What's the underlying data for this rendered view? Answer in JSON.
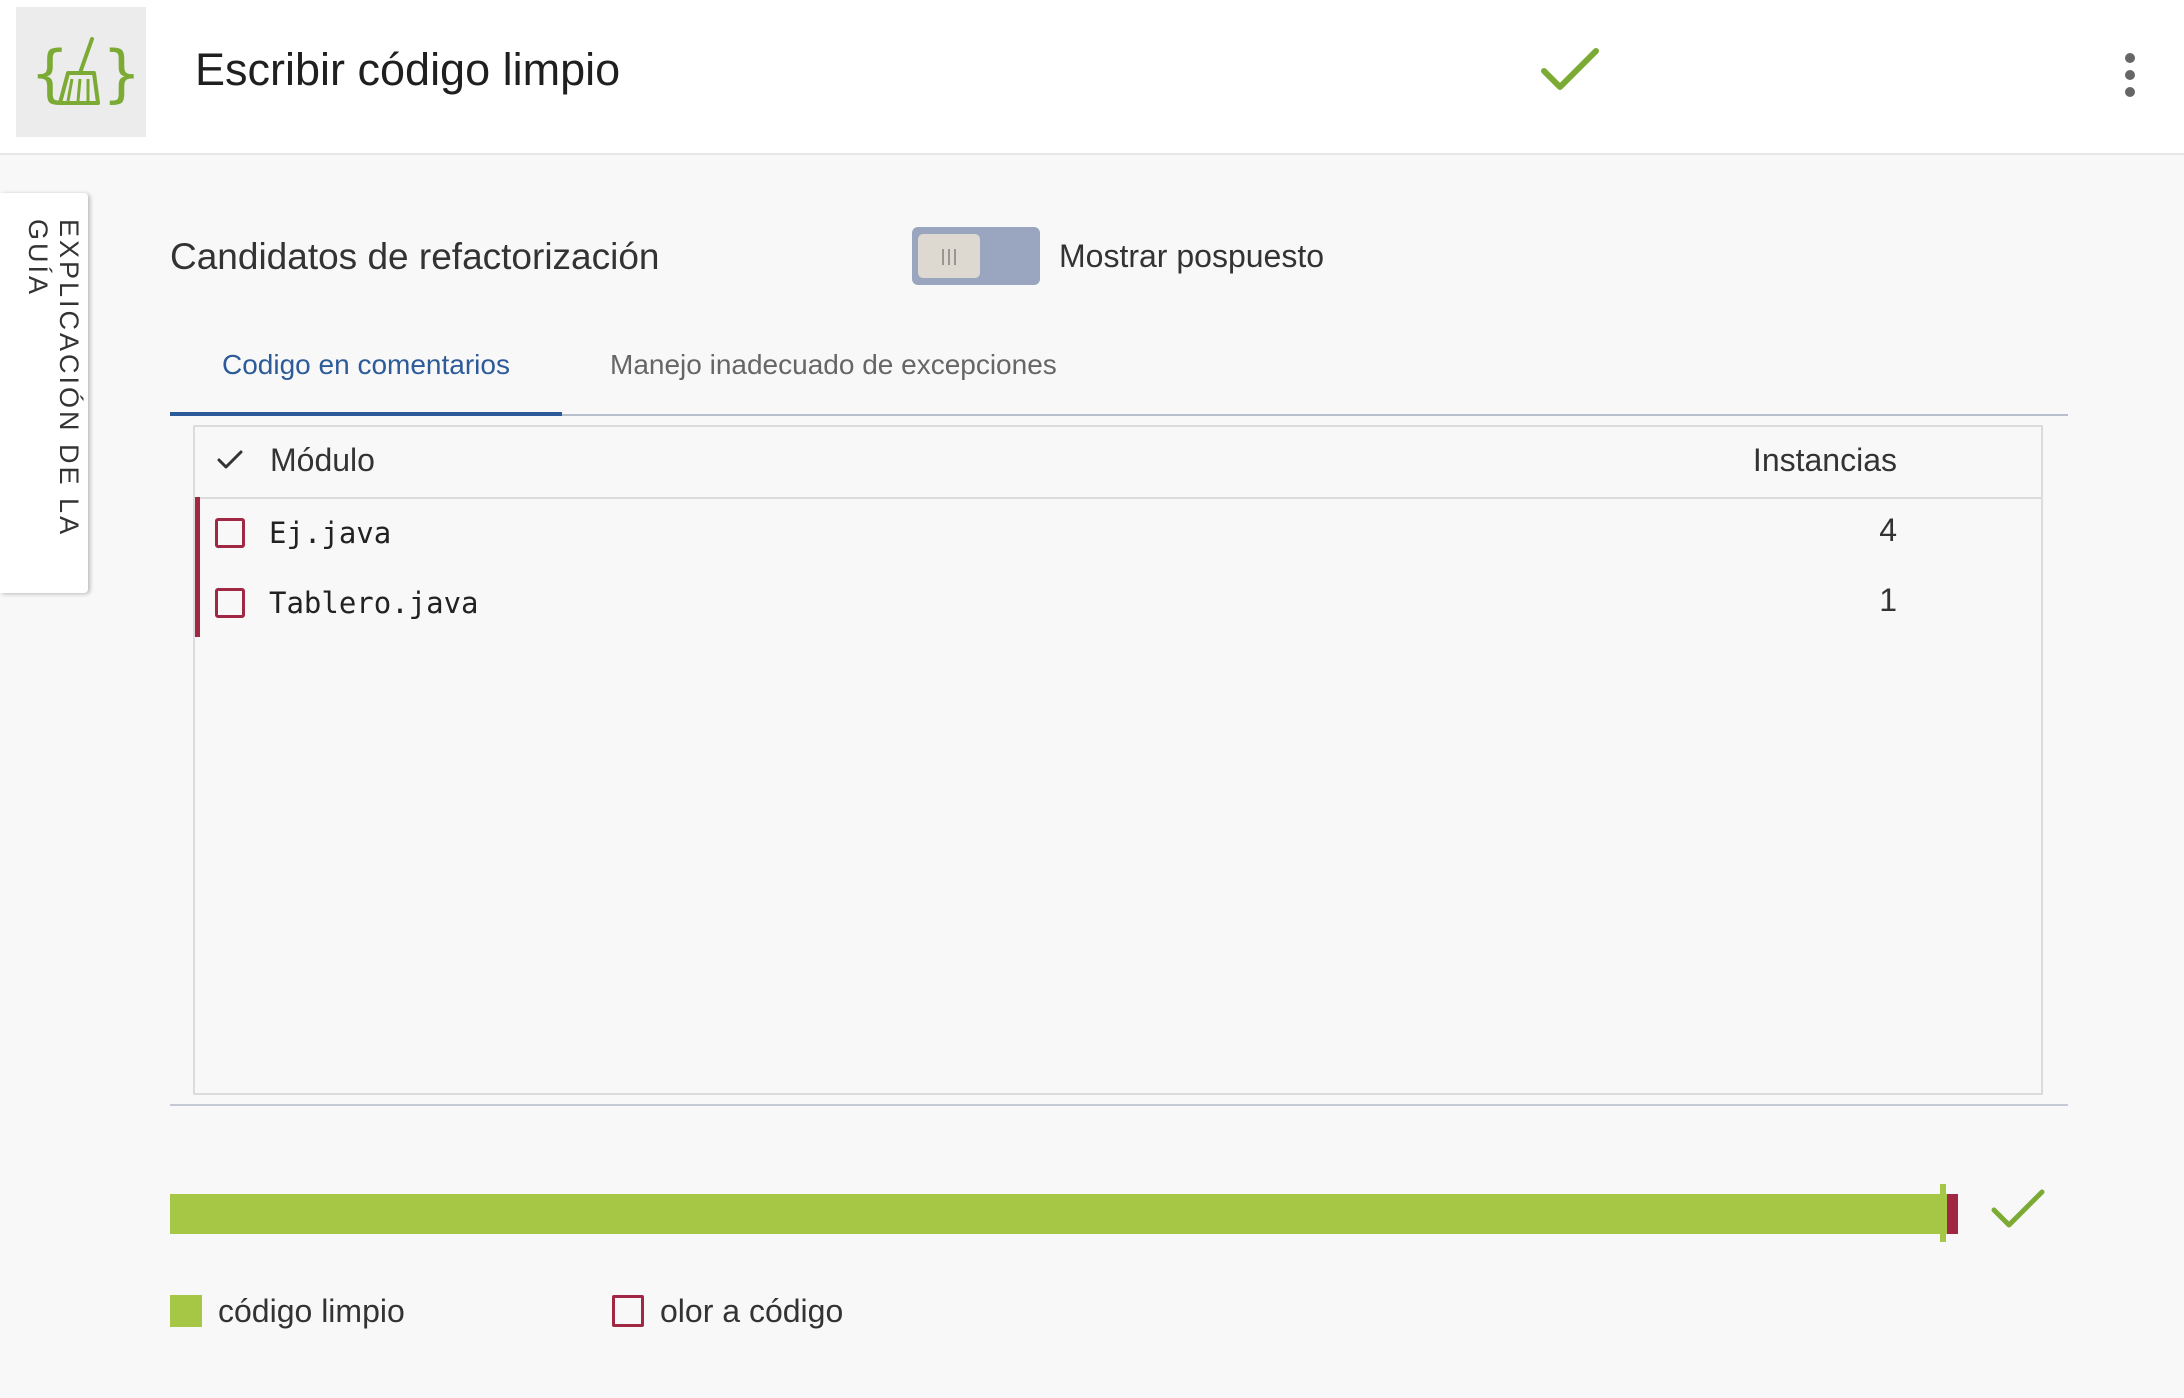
{
  "header": {
    "title": "Escribir código limpio",
    "logo_icon": "clean-code-broom-icon",
    "status_icon": "checkmark-icon",
    "menu_icon": "kebab-menu-icon"
  },
  "side_tab": {
    "label": "EXPLICACIÓN DE LA GUÍA"
  },
  "section": {
    "title": "Candidatos de refactorización",
    "toggle_label": "Mostrar pospuesto",
    "toggle_on": false
  },
  "tabs": [
    {
      "label": "Codigo en comentarios",
      "active": true
    },
    {
      "label": "Manejo inadecuado de excepciones",
      "active": false
    }
  ],
  "table": {
    "columns": [
      "Módulo",
      "Instancias"
    ],
    "rows": [
      {
        "module": "Ej.java",
        "instances": "4",
        "checked": false
      },
      {
        "module": "Tablero.java",
        "instances": "1",
        "checked": false
      }
    ]
  },
  "progress": {
    "clean_fraction": 0.994,
    "status_icon": "checkmark-icon"
  },
  "legend": [
    {
      "label": "código limpio"
    },
    {
      "label": "olor a código"
    }
  ],
  "colors": {
    "clean": "#a6c646",
    "smell": "#a02845",
    "accent": "#2d5b99"
  }
}
